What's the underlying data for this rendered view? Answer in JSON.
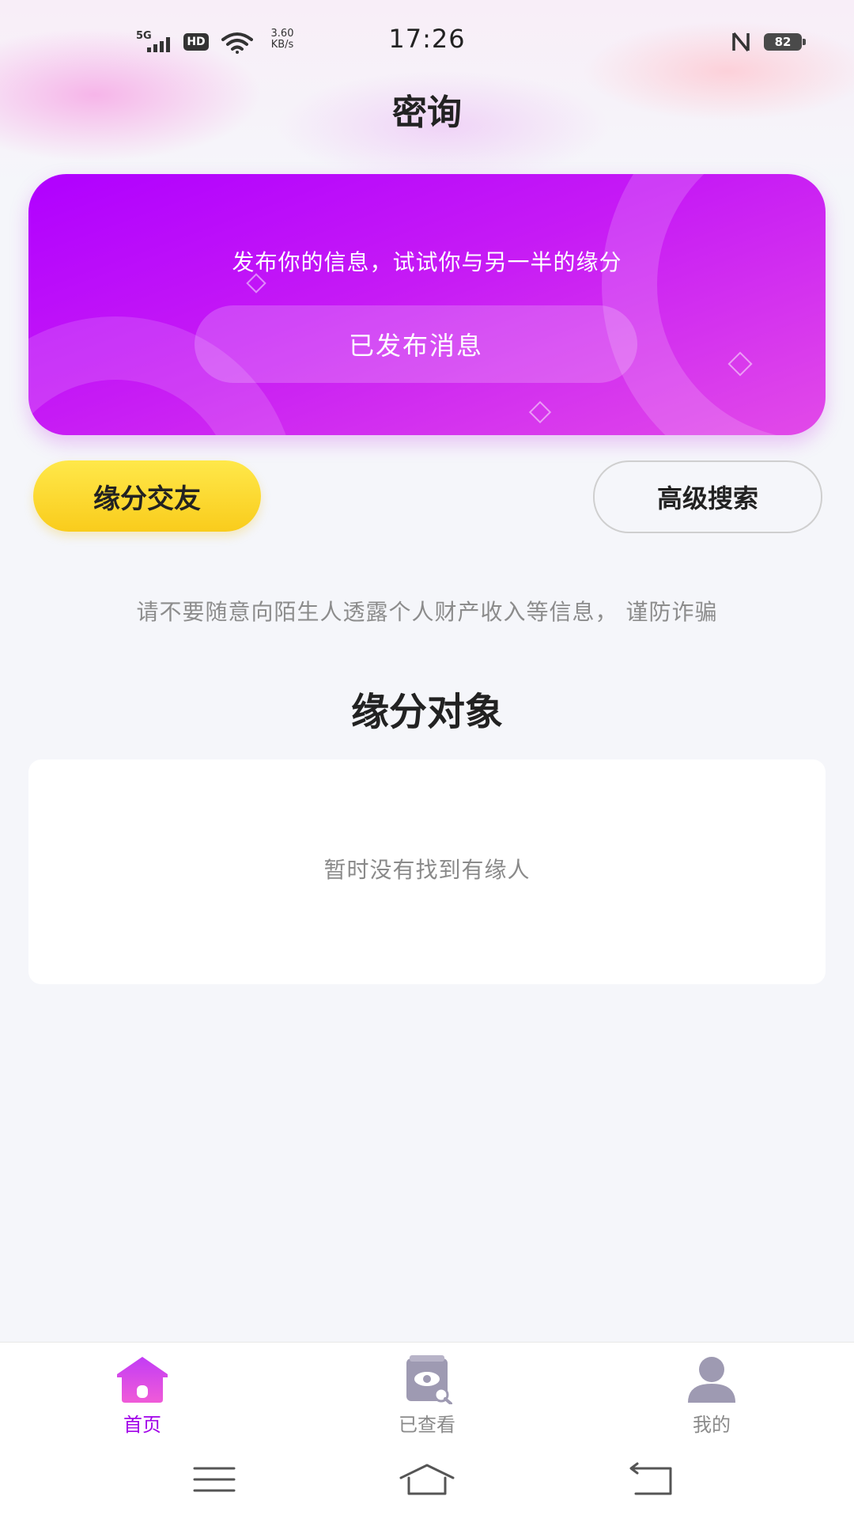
{
  "status_bar": {
    "network": "5G",
    "hd": "HD",
    "speed_value": "3.60",
    "speed_unit": "KB/s",
    "time": "17:26",
    "battery": "82"
  },
  "header": {
    "title": "密询"
  },
  "banner": {
    "text": "发布你的信息，试试你与另一半的缘分",
    "button_label": "已发布消息"
  },
  "actions": {
    "yuanfen_label": "缘分交友",
    "search_label": "高级搜索"
  },
  "warning_text": "请不要随意向陌生人透露个人财产收入等信息，  谨防诈骗",
  "section": {
    "title": "缘分对象",
    "empty_text": "暂时没有找到有缘人"
  },
  "tabbar": {
    "items": [
      {
        "label": "首页",
        "icon": "home-icon",
        "active": true
      },
      {
        "label": "已查看",
        "icon": "viewed-icon",
        "active": false
      },
      {
        "label": "我的",
        "icon": "user-icon",
        "active": false
      }
    ]
  },
  "colors": {
    "accent": "#a100e8",
    "banner_start": "#b000ff",
    "banner_end": "#e24ae8",
    "yellow": "#f9cc1c"
  }
}
